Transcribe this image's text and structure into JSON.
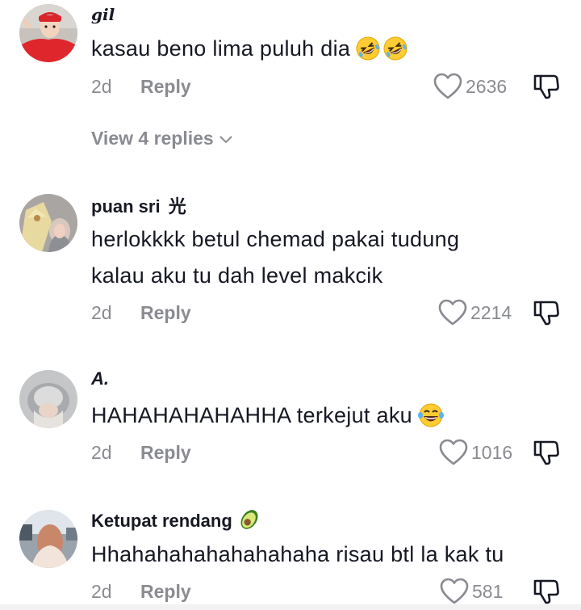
{
  "comments": [
    {
      "username": "𝒈𝒊𝒍",
      "text_lines": [
        "kasau beno lima puluh dia"
      ],
      "emojis": [
        "rolling-on-floor-laughing-emoji",
        "rolling-on-floor-laughing-emoji"
      ],
      "age": "2d",
      "reply_label": "Reply",
      "likes": "2636",
      "view_replies": "View 4 replies"
    },
    {
      "username": "puan sri",
      "username_suffix": "光",
      "text_lines": [
        "herlokkkk betul chemad pakai tudung",
        "kalau aku tu dah level makcik"
      ],
      "age": "2d",
      "reply_label": "Reply",
      "likes": "2214"
    },
    {
      "username": "A.",
      "text_lines": [
        "HAHAHAHAHAHHA terkejut aku"
      ],
      "emojis": [
        "face-with-tears-of-joy-emoji"
      ],
      "age": "2d",
      "reply_label": "Reply",
      "likes": "1016"
    },
    {
      "username": "Ketupat rendang",
      "username_emoji": "avocado-emoji",
      "text_lines": [
        "Hhahahahahahahahaha risau btl la kak tu"
      ],
      "age": "2d",
      "reply_label": "Reply",
      "likes": "581"
    }
  ],
  "icons": {
    "like": "heart-outline-icon",
    "dislike": "thumbs-down-outline-icon",
    "expand": "chevron-down-icon"
  },
  "colors": {
    "text": "#161823",
    "secondary": "#8a8b91"
  }
}
